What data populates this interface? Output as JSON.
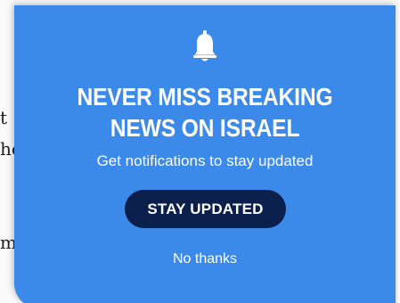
{
  "background_text": {
    "line1": "t",
    "line2": "he",
    "line3": "m,"
  },
  "popup": {
    "icon": "bell-icon",
    "title_line1": "NEVER MISS BREAKING",
    "title_line2": "NEWS ON ISRAEL",
    "subtitle": "Get notifications to stay updated",
    "primary_button_label": "STAY UPDATED",
    "dismiss_label": "No thanks"
  },
  "colors": {
    "popup_background": "#3b8ae9",
    "primary_button": "#0b1f4d",
    "text": "#ffffff"
  }
}
